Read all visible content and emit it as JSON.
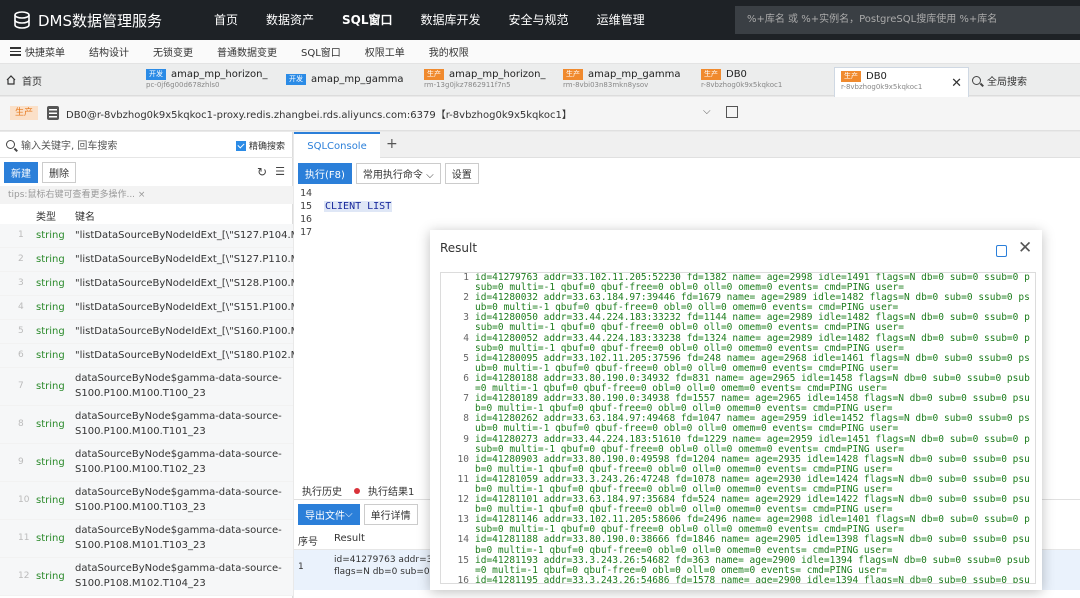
{
  "brand": {
    "name": "DMS数据管理服务"
  },
  "top_menu": [
    "首页",
    "数据资产",
    "SQL窗口",
    "数据库开发",
    "安全与规范",
    "运维管理"
  ],
  "top_search": {
    "placeholder": "%+库名 或 %+实例名，PostgreSQL搜库使用 %+库名"
  },
  "sub_menu": [
    "快捷菜单",
    "结构设计",
    "无锁变更",
    "普通数据变更",
    "SQL窗口",
    "权限工单",
    "我的权限"
  ],
  "tabs": {
    "home": "首页",
    "items": [
      {
        "tag": "开发",
        "kind": "dev",
        "name": "amap_mp_horizon_",
        "sub": "pc-0jf6g00d678zhls0"
      },
      {
        "tag": "开发",
        "kind": "dev",
        "name": "amap_mp_gamma",
        "sub": ""
      },
      {
        "tag": "生产",
        "kind": "prod",
        "name": "amap_mp_horizon_",
        "sub": "rm-13g0jkz7862911f7n5"
      },
      {
        "tag": "生产",
        "kind": "prod",
        "name": "amap_mp_gamma",
        "sub": "rm-8vbi03n83mkn8ysov"
      },
      {
        "tag": "生产",
        "kind": "prod",
        "name": "DB0",
        "sub": "r-8vbzhog0k9x5kqkoc1"
      },
      {
        "tag": "生产",
        "kind": "prod",
        "name": "DB0",
        "sub": "r-8vbzhog0k9x5kqkoc1"
      }
    ],
    "global_search": "全局搜索"
  },
  "connection": {
    "env_tag": "生产",
    "text": "DB0@r-8vbzhog0k9x5kqkoc1-proxy.redis.zhangbei.rds.aliyuncs.com:6379【r-8vbzhog0k9x5kqkoc1】"
  },
  "left": {
    "search_placeholder": "输入关键字, 回车搜索",
    "fuzzy_label": "精确搜索",
    "new_btn": "新建",
    "delete_btn": "删除",
    "tips": "tips:鼠标右键可查看更多操作...  ×",
    "col_type": "类型",
    "col_key": "键名",
    "rows": [
      {
        "idx": "1",
        "type": "string",
        "name": "\"listDataSourceByNodeIdExt_[\\\"S127.P104.M1..."
      },
      {
        "idx": "2",
        "type": "string",
        "name": "\"listDataSourceByNodeIdExt_[\\\"S127.P110.M1..."
      },
      {
        "idx": "3",
        "type": "string",
        "name": "\"listDataSourceByNodeIdExt_[\\\"S128.P100.M1..."
      },
      {
        "idx": "4",
        "type": "string",
        "name": "\"listDataSourceByNodeIdExt_[\\\"S151.P100.M1..."
      },
      {
        "idx": "5",
        "type": "string",
        "name": "\"listDataSourceByNodeIdExt_[\\\"S160.P100.M1..."
      },
      {
        "idx": "6",
        "type": "string",
        "name": "\"listDataSourceByNodeIdExt_[\\\"S180.P102.M1..."
      },
      {
        "idx": "7",
        "type": "string",
        "name": "dataSourceByNode$gamma-data-source-",
        "name2": "S100.P100.M100.T100_23"
      },
      {
        "idx": "8",
        "type": "string",
        "name": "dataSourceByNode$gamma-data-source-",
        "name2": "S100.P100.M100.T101_23"
      },
      {
        "idx": "9",
        "type": "string",
        "name": "dataSourceByNode$gamma-data-source-",
        "name2": "S100.P100.M100.T102_23"
      },
      {
        "idx": "10",
        "type": "string",
        "name": "dataSourceByNode$gamma-data-source-",
        "name2": "S100.P100.M100.T103_23"
      },
      {
        "idx": "11",
        "type": "string",
        "name": "dataSourceByNode$gamma-data-source-",
        "name2": "S100.P108.M101.T103_23"
      },
      {
        "idx": "12",
        "type": "string",
        "name": "dataSourceByNode$gamma-data-source-",
        "name2": "S100.P108.M102.T104_23"
      }
    ]
  },
  "console": {
    "tab": "SQLConsole",
    "exec_btn": "执行(F8)",
    "common_cmds": "常用执行命令",
    "settings": "设置",
    "lines": [
      {
        "n": "14",
        "code": ""
      },
      {
        "n": "15",
        "code": "CLIENT LIST"
      },
      {
        "n": "16",
        "code": ""
      },
      {
        "n": "17",
        "code": ""
      }
    ],
    "bottom_tabs": {
      "history": "执行历史",
      "result": "执行结果1"
    },
    "export_btn": "导出文件",
    "detail_btn": "单行详情",
    "col_seq": "序号",
    "col_result": "Result",
    "row_idx": "1",
    "row_val1": "id=41279763 addr=33.",
    "row_val2": "flags=N db=0 sub=0 s"
  },
  "modal": {
    "title": "Result",
    "lines": [
      {
        "n": "1",
        "t": "id=41279763 addr=33.102.11.205:52230 fd=1382 name= age=2998 idle=1491 flags=N db=0 sub=0 ssub=0 psub=0 multi=-1 qbuf=0 qbuf-free=0 obl=0 oll=0 omem=0 events= cmd=PING user="
      },
      {
        "n": "2",
        "t": "id=41280032 addr=33.63.184.97:39446 fd=1679 name= age=2989 idle=1482 flags=N db=0 sub=0 ssub=0 psub=0 multi=-1 qbuf=0 qbuf-free=0 obl=0 oll=0 omem=0 events= cmd=PING user="
      },
      {
        "n": "3",
        "t": "id=41280050 addr=33.44.224.183:33232 fd=1144 name= age=2989 idle=1482 flags=N db=0 sub=0 ssub=0 psub=0 multi=-1 qbuf=0 qbuf-free=0 obl=0 oll=0 omem=0 events= cmd=PING user="
      },
      {
        "n": "4",
        "t": "id=41280052 addr=33.44.224.183:33238 fd=1324 name= age=2989 idle=1482 flags=N db=0 sub=0 ssub=0 psub=0 multi=-1 qbuf=0 qbuf-free=0 obl=0 oll=0 omem=0 events= cmd=PING user="
      },
      {
        "n": "5",
        "t": "id=41280095 addr=33.102.11.205:37596 fd=248 name= age=2968 idle=1461 flags=N db=0 sub=0 ssub=0 psub=0 multi=-1 qbuf=0 qbuf-free=0 obl=0 oll=0 omem=0 events= cmd=PING user="
      },
      {
        "n": "6",
        "t": "id=41280188 addr=33.80.190.0:34932 fd=831 name= age=2965 idle=1458 flags=N db=0 sub=0 ssub=0 psub=0 multi=-1 qbuf=0 qbuf-free=0 obl=0 oll=0 omem=0 events= cmd=PING user="
      },
      {
        "n": "7",
        "t": "id=41280189 addr=33.80.190.0:34938 fd=1557 name= age=2965 idle=1458 flags=N db=0 sub=0 ssub=0 psub=0 multi=-1 qbuf=0 qbuf-free=0 obl=0 oll=0 omem=0 events= cmd=PING user="
      },
      {
        "n": "8",
        "t": "id=41280262 addr=33.63.184.97:49468 fd=1047 name= age=2959 idle=1452 flags=N db=0 sub=0 ssub=0 psub=0 multi=-1 qbuf=0 qbuf-free=0 obl=0 oll=0 omem=0 events= cmd=PING user="
      },
      {
        "n": "9",
        "t": "id=41280273 addr=33.44.224.183:51610 fd=1229 name= age=2959 idle=1451 flags=N db=0 sub=0 ssub=0 psub=0 multi=-1 qbuf=0 qbuf-free=0 obl=0 oll=0 omem=0 events= cmd=PING user="
      },
      {
        "n": "10",
        "t": "id=41280903 addr=33.80.190.0:49598 fd=1204 name= age=2935 idle=1428 flags=N db=0 sub=0 ssub=0 psub=0 multi=-1 qbuf=0 qbuf-free=0 obl=0 oll=0 omem=0 events= cmd=PING user="
      },
      {
        "n": "11",
        "t": "id=41281059 addr=33.3.243.26:47248 fd=1078 name= age=2930 idle=1424 flags=N db=0 sub=0 ssub=0 psub=0 multi=-1 qbuf=0 qbuf-free=0 obl=0 oll=0 omem=0 events= cmd=PING user="
      },
      {
        "n": "12",
        "t": "id=41281101 addr=33.63.184.97:35684 fd=524 name= age=2929 idle=1422 flags=N db=0 sub=0 ssub=0 psub=0 multi=-1 qbuf=0 qbuf-free=0 obl=0 oll=0 omem=0 events= cmd=PING user="
      },
      {
        "n": "13",
        "t": "id=41281146 addr=33.102.11.205:58606 fd=2496 name= age=2908 idle=1401 flags=N db=0 sub=0 ssub=0 psub=0 multi=-1 qbuf=0 qbuf-free=0 obl=0 oll=0 omem=0 events= cmd=PING user="
      },
      {
        "n": "14",
        "t": "id=41281188 addr=33.80.190.0:38666 fd=1846 name= age=2905 idle=1398 flags=N db=0 sub=0 ssub=0 psub=0 multi=-1 qbuf=0 qbuf-free=0 obl=0 oll=0 omem=0 events= cmd=PING user="
      },
      {
        "n": "15",
        "t": "id=41281193 addr=33.3.243.26:54682 fd=363 name= age=2900 idle=1394 flags=N db=0 sub=0 ssub=0 psub=0 multi=-1 qbuf=0 qbuf-free=0 obl=0 oll=0 omem=0 events= cmd=PING user="
      },
      {
        "n": "16",
        "t": "id=41281195 addr=33.3.243.26:54686 fd=1578 name= age=2900 idle=1394 flags=N db=0 sub=0 ssub=0 psub=0"
      }
    ]
  }
}
